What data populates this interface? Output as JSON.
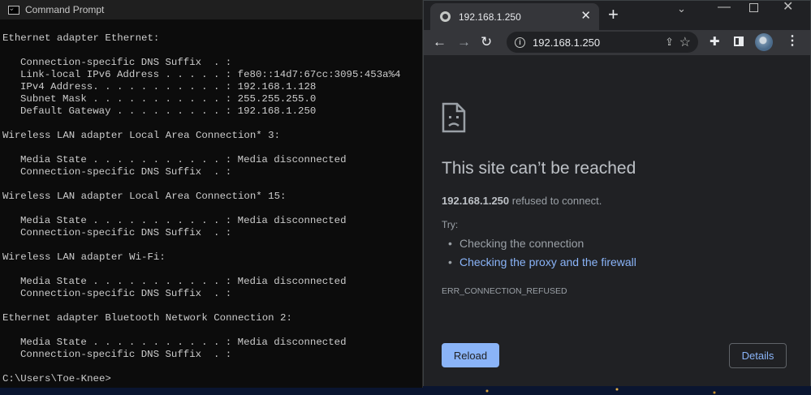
{
  "cmd": {
    "title": "Command Prompt",
    "lines": [
      {
        "text": "Ethernet adapter Ethernet:",
        "indent": false
      },
      {
        "text": "",
        "indent": false
      },
      {
        "text": "Connection-specific DNS Suffix  . :",
        "indent": true
      },
      {
        "text": "Link-local IPv6 Address . . . . . : fe80::14d7:67cc:3095:453a%4",
        "indent": true
      },
      {
        "text": "IPv4 Address. . . . . . . . . . . : 192.168.1.128",
        "indent": true
      },
      {
        "text": "Subnet Mask . . . . . . . . . . . : 255.255.255.0",
        "indent": true
      },
      {
        "text": "Default Gateway . . . . . . . . . : 192.168.1.250",
        "indent": true
      },
      {
        "text": "",
        "indent": false
      },
      {
        "text": "Wireless LAN adapter Local Area Connection* 3:",
        "indent": false
      },
      {
        "text": "",
        "indent": false
      },
      {
        "text": "Media State . . . . . . . . . . . : Media disconnected",
        "indent": true
      },
      {
        "text": "Connection-specific DNS Suffix  . :",
        "indent": true
      },
      {
        "text": "",
        "indent": false
      },
      {
        "text": "Wireless LAN adapter Local Area Connection* 15:",
        "indent": false
      },
      {
        "text": "",
        "indent": false
      },
      {
        "text": "Media State . . . . . . . . . . . : Media disconnected",
        "indent": true
      },
      {
        "text": "Connection-specific DNS Suffix  . :",
        "indent": true
      },
      {
        "text": "",
        "indent": false
      },
      {
        "text": "Wireless LAN adapter Wi-Fi:",
        "indent": false
      },
      {
        "text": "",
        "indent": false
      },
      {
        "text": "Media State . . . . . . . . . . . : Media disconnected",
        "indent": true
      },
      {
        "text": "Connection-specific DNS Suffix  . :",
        "indent": true
      },
      {
        "text": "",
        "indent": false
      },
      {
        "text": "Ethernet adapter Bluetooth Network Connection 2:",
        "indent": false
      },
      {
        "text": "",
        "indent": false
      },
      {
        "text": "Media State . . . . . . . . . . . : Media disconnected",
        "indent": true
      },
      {
        "text": "Connection-specific DNS Suffix  . :",
        "indent": true
      },
      {
        "text": "",
        "indent": false
      },
      {
        "text": "C:\\Users\\Toe-Knee>",
        "indent": false
      }
    ]
  },
  "browser": {
    "tab_title": "192.168.1.250",
    "tab_close": "✕",
    "new_tab": "+",
    "url": "192.168.1.250",
    "error": {
      "title": "This site can’t be reached",
      "host": "192.168.1.250",
      "desc_suffix": " refused to connect.",
      "try_label": "Try:",
      "suggestions": [
        "Checking the connection",
        "Checking the proxy and the firewall"
      ],
      "code": "ERR_CONNECTION_REFUSED",
      "reload_label": "Reload",
      "details_label": "Details"
    },
    "colors": {
      "background": "#202124",
      "accent": "#8ab4f8",
      "text": "#bdc1c6"
    }
  }
}
